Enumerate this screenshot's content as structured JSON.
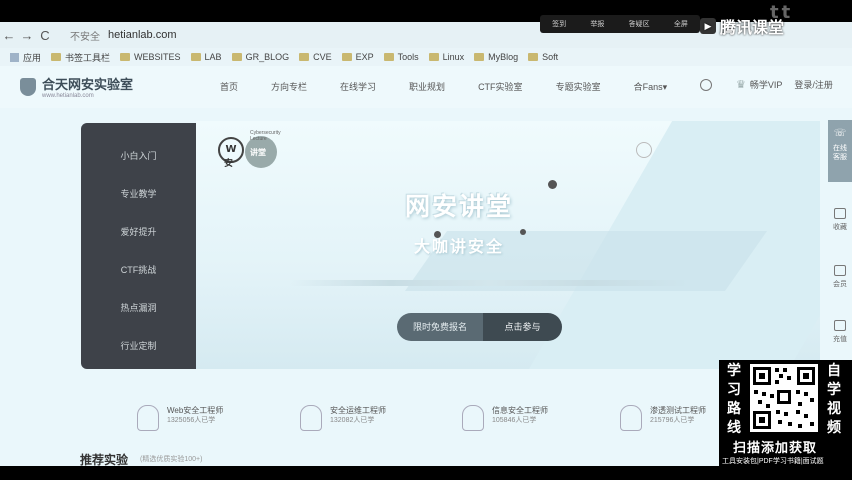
{
  "overlay": {
    "watermark": "tt",
    "tencent_toolbar": [
      "签到",
      "举报",
      "答疑区",
      "全屏"
    ],
    "tencent_brand": "腾讯课堂"
  },
  "browser": {
    "back": "←",
    "forward": "→",
    "reload": "C",
    "security": "不安全",
    "url": "hetianlab.com",
    "bookmarks": [
      "应用",
      "书签工具栏",
      "WEBSITES",
      "LAB",
      "GR_BLOG",
      "CVE",
      "EXP",
      "Tools",
      "Linux",
      "MyBlog",
      "Soft"
    ]
  },
  "site": {
    "logo": "合天网安实验室",
    "logo_sub": "www.hetianlab.com",
    "nav": [
      "首页",
      "方向专栏",
      "在线学习",
      "职业规划",
      "CTF实验室",
      "专题实验室",
      "合Fans▾"
    ],
    "vip": "畅学VIP",
    "login": "登录/注册"
  },
  "menu": [
    "小白入门",
    "专业教学",
    "爱好提升",
    "CTF挑战",
    "热点漏洞",
    "行业定制"
  ],
  "banner": {
    "brand_w": "W",
    "brand_an": "安",
    "brand_sub": "Cybersecurity Lecture",
    "brand_jt": "讲堂",
    "title": "网安讲堂",
    "subtitle": "大咖讲安全",
    "cta_left": "限时免费报名",
    "cta_right": "点击参与"
  },
  "rail": [
    "在线客服",
    "收藏",
    "会员",
    "充值"
  ],
  "stats": [
    {
      "title": "Web安全工程师",
      "count": "1325056人已学"
    },
    {
      "title": "安全运维工程师",
      "count": "132082人已学"
    },
    {
      "title": "信息安全工程师",
      "count": "105846人已学"
    },
    {
      "title": "渗透测试工程师",
      "count": "215796人已学"
    }
  ],
  "recommend": "推荐实验",
  "recommend_sub": "(精选优质实验100+)",
  "promo": {
    "left": [
      "学",
      "习",
      "路",
      "线"
    ],
    "right": [
      "自",
      "学",
      "视",
      "频"
    ],
    "big": "扫描添加获取",
    "small": "工具安装包|PDF学习书籍|面试题"
  }
}
